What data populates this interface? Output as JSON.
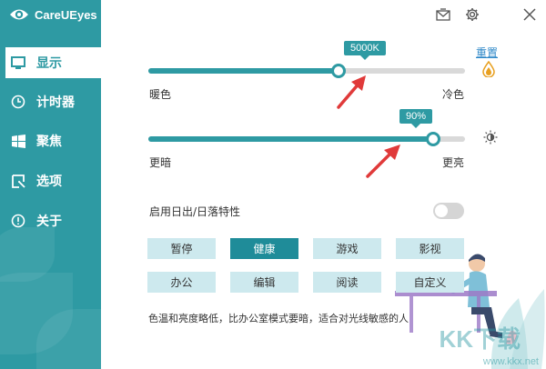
{
  "app": {
    "title": "CareUEyes"
  },
  "titlebar": {
    "icons": [
      "mail-icon",
      "gear-icon",
      "close-icon"
    ]
  },
  "sidebar": {
    "items": [
      {
        "label": "显示",
        "icon": "monitor-icon",
        "active": true
      },
      {
        "label": "计时器",
        "icon": "clock-icon",
        "active": false
      },
      {
        "label": "聚焦",
        "icon": "windows-icon",
        "active": false
      },
      {
        "label": "选项",
        "icon": "options-icon",
        "active": false
      },
      {
        "label": "关于",
        "icon": "info-icon",
        "active": false
      }
    ]
  },
  "main": {
    "reset_label": "重置",
    "color_temp": {
      "value_label": "5000K",
      "level": 0.6,
      "left_label": "暖色",
      "right_label": "冷色"
    },
    "brightness": {
      "value_label": "90%",
      "level": 0.9,
      "left_label": "更暗",
      "right_label": "更亮"
    },
    "sunrise_label": "启用日出/日落特性",
    "sunrise_enabled": false,
    "modes_row1": [
      "暂停",
      "健康",
      "游戏",
      "影视"
    ],
    "modes_row2": [
      "办公",
      "编辑",
      "阅读",
      "自定义"
    ],
    "active_mode": "健康",
    "description": "色温和亮度略低，比办公室模式要暗，适合对光线敏感的人"
  },
  "watermark": {
    "logo": "KK下载",
    "url": "www.kkx.net"
  },
  "colors": {
    "accent": "#2e9aa3",
    "mode_bg": "#cde9ee",
    "mode_active": "#1f8c99",
    "arrow": "#e03a3a",
    "link": "#2e88c8"
  }
}
